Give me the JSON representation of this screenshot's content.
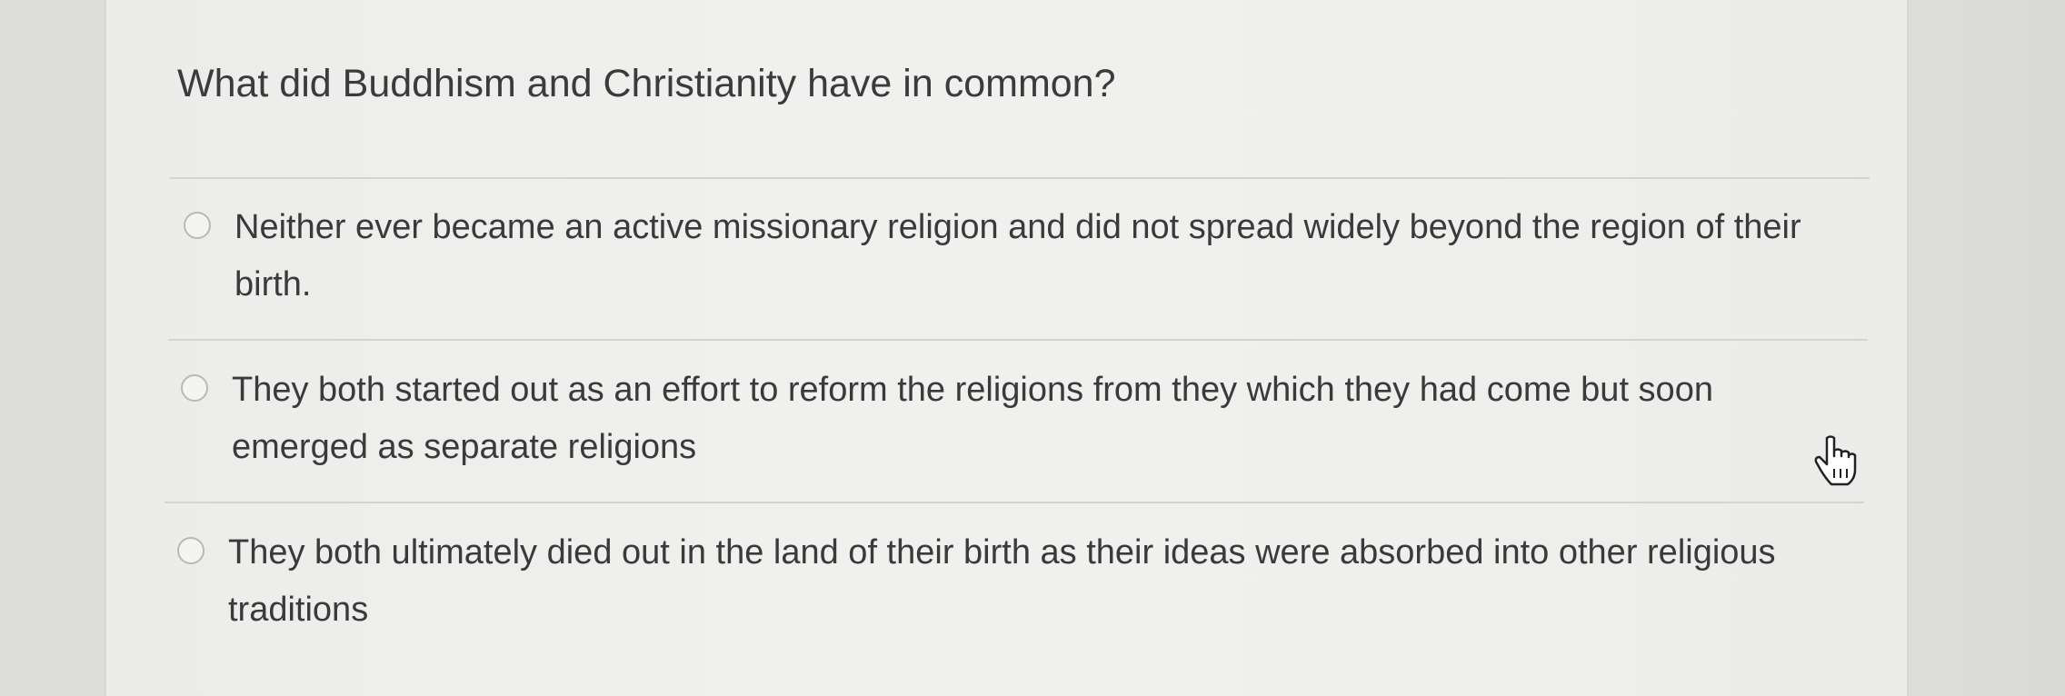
{
  "question": {
    "text": "What did Buddhism and Christianity have in common?"
  },
  "options": [
    {
      "text": "Neither ever became an active missionary religion and did not spread widely beyond the region of their birth.",
      "selected": false
    },
    {
      "text": "They both started out as an effort to reform the religions from they which they had come but soon emerged as separate religions",
      "selected": false
    },
    {
      "text": "They both ultimately died out in the land of their birth as their ideas were absorbed into other religious traditions",
      "selected": false
    }
  ],
  "cursor": {
    "icon": "hand-pointer-icon"
  }
}
